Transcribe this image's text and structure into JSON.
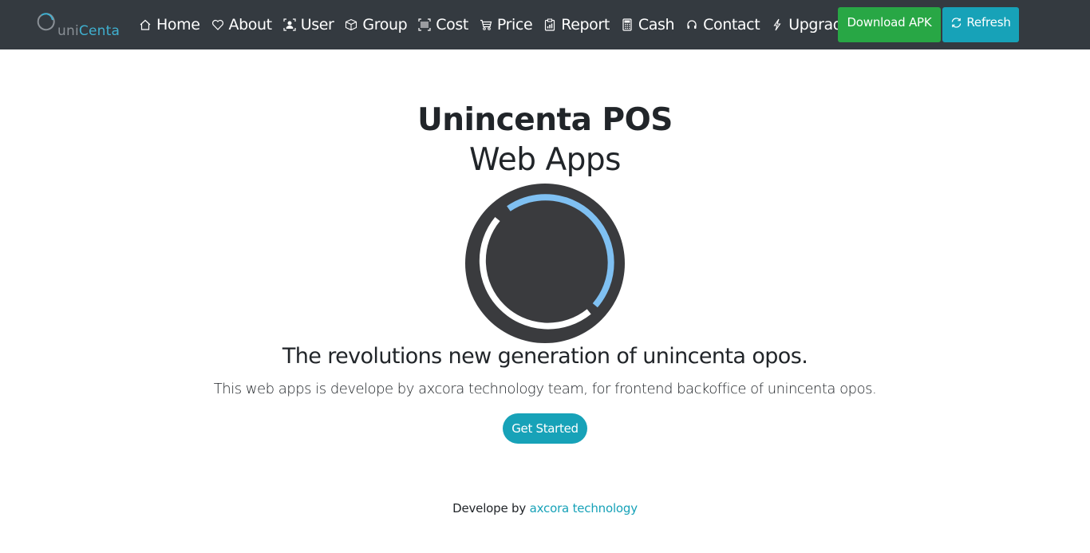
{
  "brand": {
    "prefix": "uni",
    "suffix": "Centa"
  },
  "nav": {
    "items": [
      {
        "label": "Home",
        "icon": "home-icon"
      },
      {
        "label": "About",
        "icon": "heart-icon"
      },
      {
        "label": "User",
        "icon": "user-icon"
      },
      {
        "label": "Group",
        "icon": "box-icon"
      },
      {
        "label": "Cost",
        "icon": "barcode-icon"
      },
      {
        "label": "Price",
        "icon": "cart-icon"
      },
      {
        "label": "Report",
        "icon": "report-icon"
      },
      {
        "label": "Cash",
        "icon": "calculator-icon"
      },
      {
        "label": "Contact",
        "icon": "headset-icon"
      },
      {
        "label": "Upgrade",
        "icon": "lightning-icon"
      }
    ],
    "download_label": "Download APK",
    "refresh_label": "Refresh"
  },
  "hero": {
    "title_bold": "Unincenta POS",
    "title_light": "Web Apps",
    "tagline": "The revolutions new generation of unincenta opos.",
    "description": "This web apps is develope by axcora technology team, for frontend backoffice of unincenta opos.",
    "cta_label": "Get Started"
  },
  "footer": {
    "prefix": "Develope by",
    "link_text": "axcora technology"
  },
  "colors": {
    "navbar": "#343a40",
    "success": "#28a745",
    "info": "#17a2b8",
    "logo_bg": "#3a3b3e",
    "logo_blue": "#7fc0f2"
  }
}
